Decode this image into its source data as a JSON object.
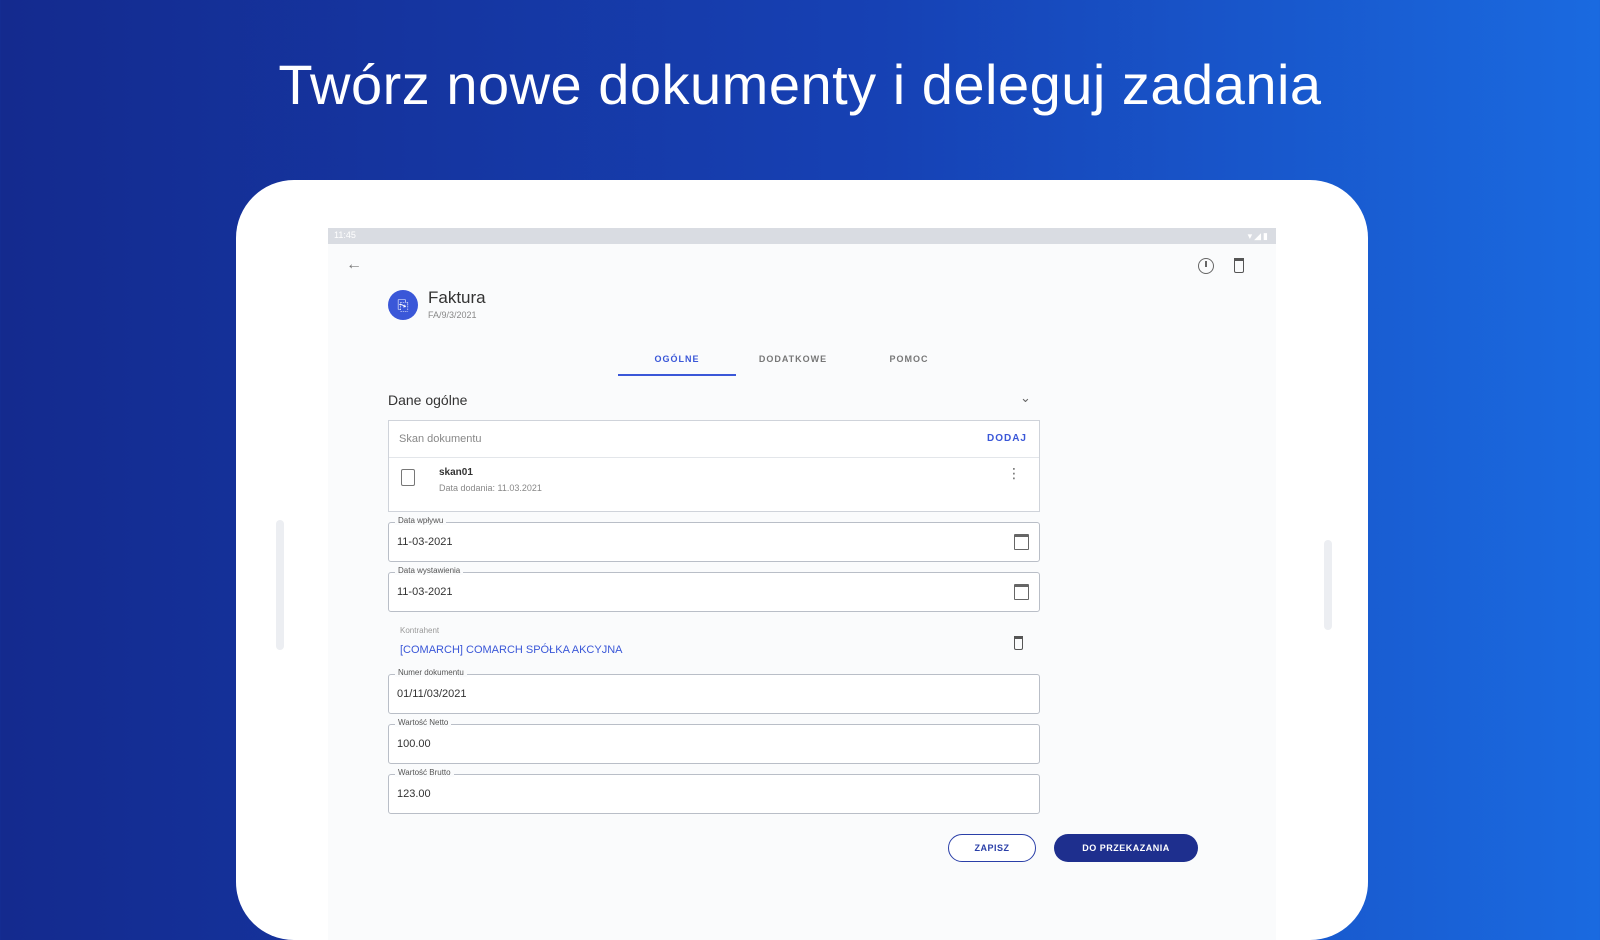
{
  "headline": "Twórz nowe dokumenty i deleguj zadania",
  "statusbar": {
    "time": "11:45"
  },
  "document": {
    "avatar_glyph": "⎘",
    "title": "Faktura",
    "number": "FA/9/3/2021"
  },
  "tabs": [
    {
      "label": "OGÓLNE",
      "active": true
    },
    {
      "label": "DODATKOWE",
      "active": false
    },
    {
      "label": "POMOC",
      "active": false
    }
  ],
  "section": {
    "title": "Dane ogólne"
  },
  "scan": {
    "label": "Skan dokumentu",
    "add_label": "DODAJ",
    "file": {
      "name": "skan01",
      "date": "Data dodania: 11.03.2021"
    }
  },
  "fields": {
    "issue_date": {
      "label": "Data wpływu",
      "value": "11-03-2021"
    },
    "issue_date2": {
      "label": "Data wystawienia",
      "value": "11-03-2021"
    },
    "contractor": {
      "label": "Kontrahent",
      "value": "[COMARCH] COMARCH SPÓŁKA AKCYJNA"
    },
    "doc_number": {
      "label": "Numer dokumentu",
      "value": "01/11/03/2021"
    },
    "net_value": {
      "label": "Wartość Netto",
      "value": "100.00"
    },
    "gross_value": {
      "label": "Wartość Brutto",
      "value": "123.00"
    }
  },
  "buttons": {
    "save": "ZAPISZ",
    "forward": "DO PRZEKAZANIA"
  },
  "colors": {
    "accent": "#3a57d8",
    "primary_dark": "#1e2f8e"
  }
}
